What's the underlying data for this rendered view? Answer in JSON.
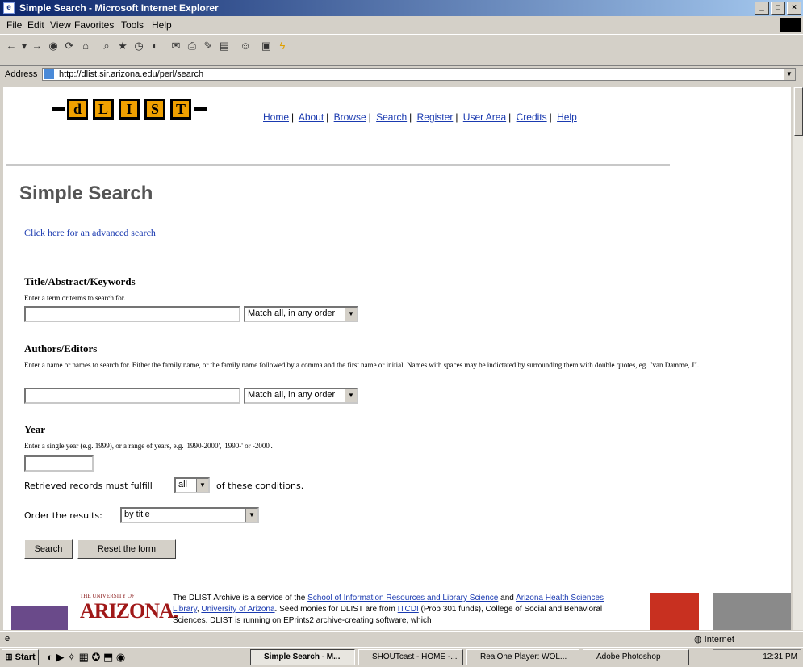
{
  "window": {
    "title": "Simple Search - Microsoft Internet Explorer",
    "controls": [
      "_",
      "□",
      "×"
    ]
  },
  "menubar": {
    "items": [
      "File",
      "Edit",
      "View",
      "Favorites",
      "Tools",
      "Help"
    ]
  },
  "address": {
    "label": "Address",
    "url": "http://dlist.sir.arizona.edu/perl/search"
  },
  "nav": {
    "items": [
      "Home",
      "About",
      "Browse",
      "Search",
      "Register",
      "User Area",
      "Credits",
      "Help"
    ]
  },
  "logo": {
    "letters": [
      "d",
      "L",
      "I",
      "S",
      "T"
    ]
  },
  "page": {
    "title": "Simple Search",
    "advanced_link": "Click here for an advanced search"
  },
  "title_section": {
    "heading": "Title/Abstract/Keywords",
    "help": "Enter a term or terms to search for.",
    "value": "",
    "match": "Match all, in any order"
  },
  "authors_section": {
    "heading": "Authors/Editors",
    "help": "Enter a name or names to search for. Either the family name, or the family name followed by a comma and the first name or initial. Names with spaces may be indictated by surrounding them with double quotes, eg. \"van Damme, J\".",
    "value": "",
    "match": "Match all, in any order"
  },
  "year_section": {
    "heading": "Year",
    "help": "Enter a single year (e.g. 1999), or a range of years, e.g. '1990-2000', '1990-' or -2000'.",
    "value": ""
  },
  "conditions": {
    "prefix": "Retrieved records must fulfill",
    "value": "all",
    "suffix": "of these conditions."
  },
  "order": {
    "label": "Order the results:",
    "value": "by title"
  },
  "buttons": {
    "search": "Search",
    "reset": "Reset the form"
  },
  "footer": {
    "uaz_small": "THE UNIVERSITY OF",
    "uaz_big": "ARIZONA.",
    "t1": "The DLIST Archive is a service of the ",
    "l1": "School of Information Resources and Library Science",
    "t2": " and ",
    "l2": "Arizona Health Sciences Library",
    "t3": ", ",
    "l3": "University of Arizona",
    "t4": ". Seed monies for DLIST are from ",
    "l4": "ITCDI",
    "t5": " (Prop 301 funds), College of Social and Behavioral Sciences. DLIST is running on EPrints2 archive-creating software, which"
  },
  "statusbar": {
    "zone": "Internet"
  },
  "taskbar": {
    "start": "Start",
    "tasks": [
      "Simple Search - M...",
      "SHOUTcast - HOME -...",
      "RealOne Player: WOL...",
      "Adobe Photoshop"
    ],
    "clock": "12:31 PM"
  }
}
